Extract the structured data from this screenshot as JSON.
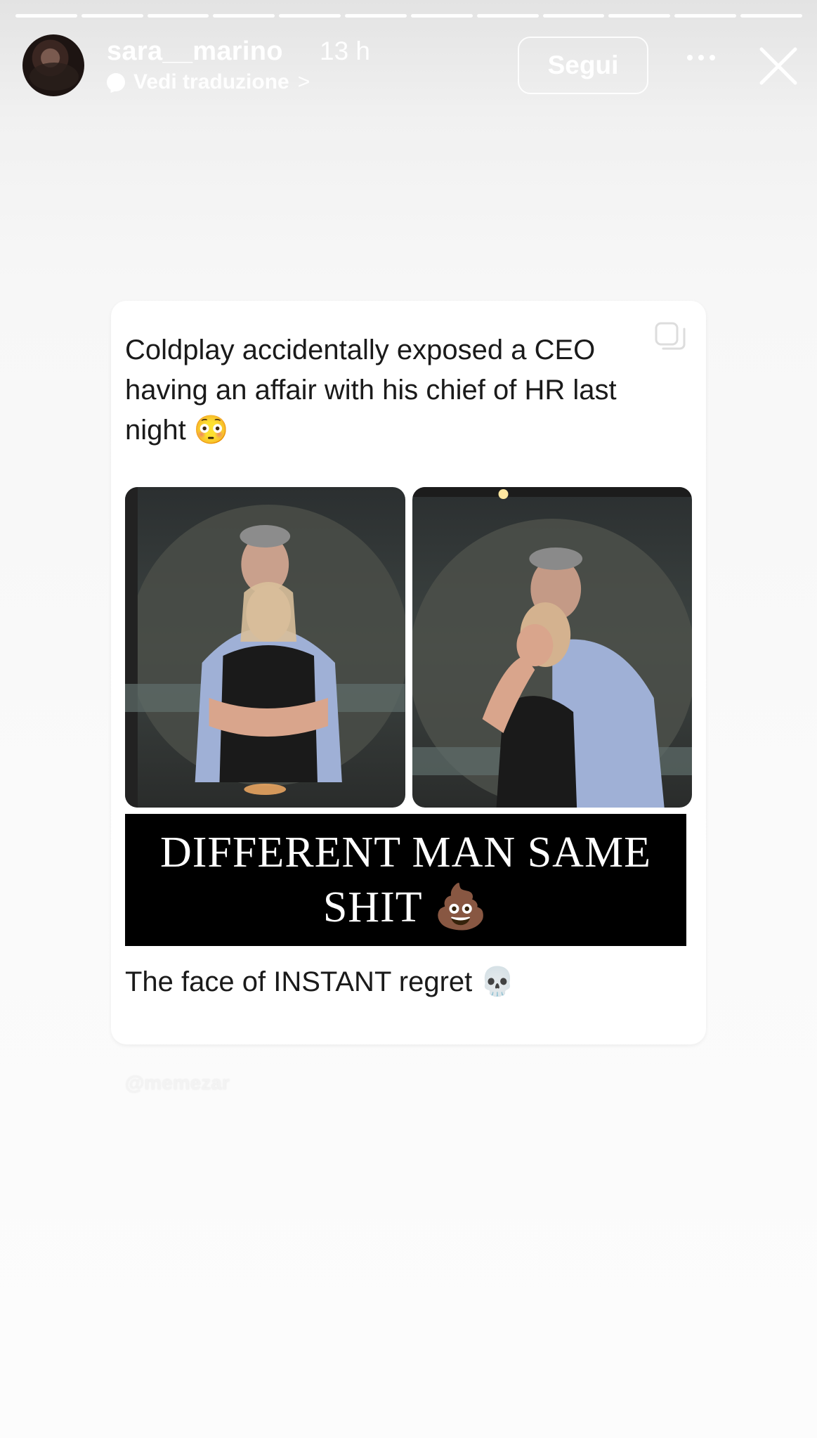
{
  "story": {
    "progress_segments": 12,
    "segments_done": 12
  },
  "header": {
    "username": "sara__marino",
    "time": "13 h",
    "translate_label": "Vedi traduzione",
    "translate_chevron": ">",
    "follow_label": "Segui",
    "icons": {
      "avatar": "avatar",
      "more": "more-horizontal-icon",
      "close": "close-icon",
      "translate": "chat-bubble-icon"
    }
  },
  "post": {
    "tweet_text": "Coldplay accidentally exposed a CEO having an affair with his chief of HR last night 😳",
    "meme_text": "DIFFERENT MAN SAME SHIT 💩",
    "caption": "The face of INSTANT regret 💀",
    "copy_icon": "copy-icon"
  },
  "watermark": "@memezar"
}
